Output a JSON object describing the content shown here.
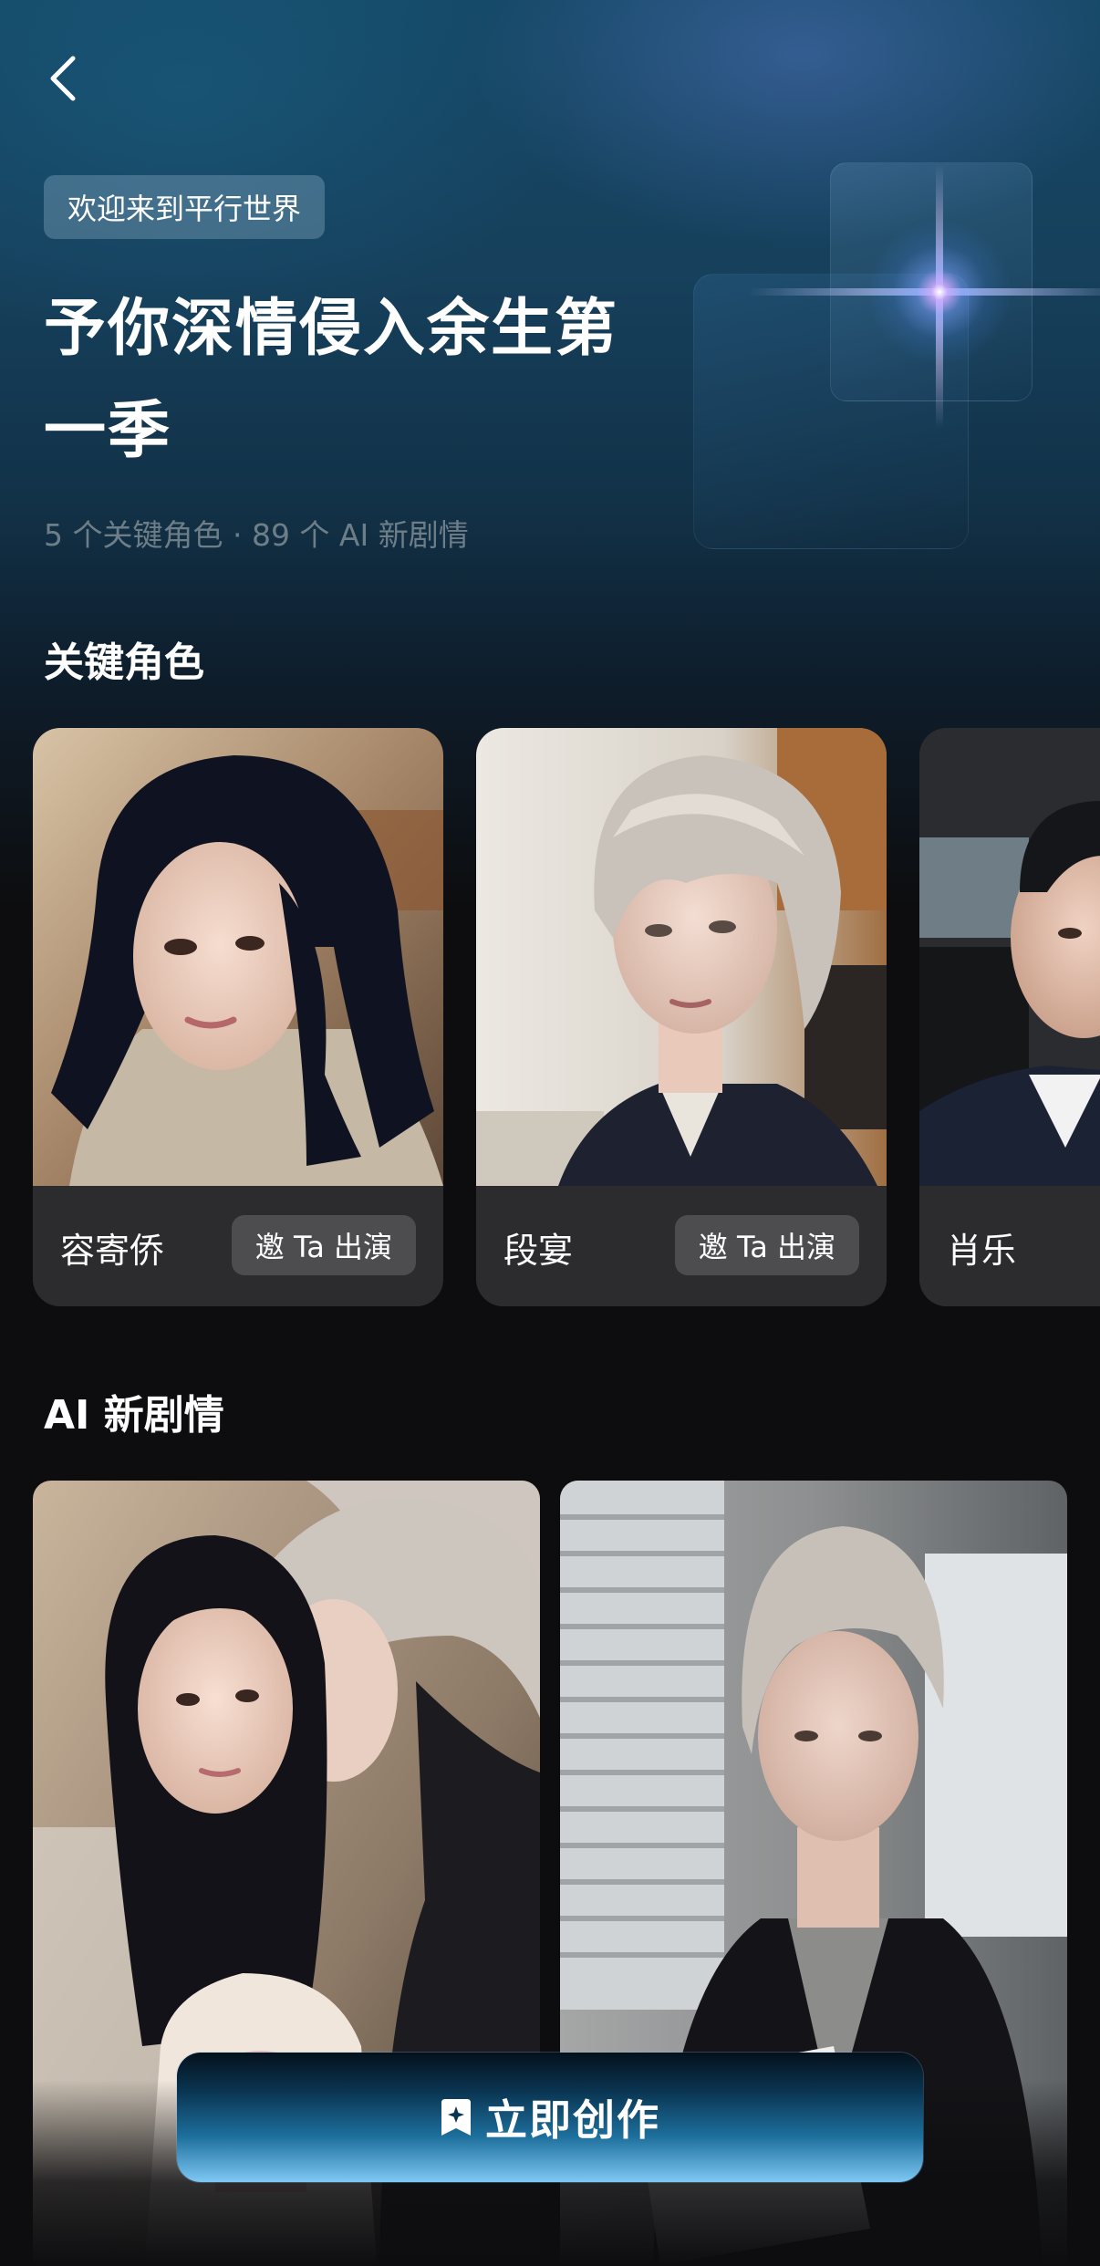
{
  "header": {
    "badge": "欢迎来到平行世界",
    "title": "予你深情侵入余生第一季",
    "subtitle": "5 个关键角色 · 89 个 AI 新剧情"
  },
  "characters_section": {
    "title": "关键角色",
    "items": [
      {
        "name": "容寄侨",
        "invite_label": "邀 Ta 出演"
      },
      {
        "name": "段宴",
        "invite_label": "邀 Ta 出演"
      },
      {
        "name": "肖乐",
        "invite_label": ""
      }
    ]
  },
  "stories_section": {
    "title": "AI 新剧情"
  },
  "cta": {
    "label": "立即创作",
    "icon": "sparkle-icon"
  },
  "icons": {
    "back": "chevron-left-icon"
  },
  "colors": {
    "accent": "#1d6f9c",
    "background": "#0d0d0f"
  }
}
